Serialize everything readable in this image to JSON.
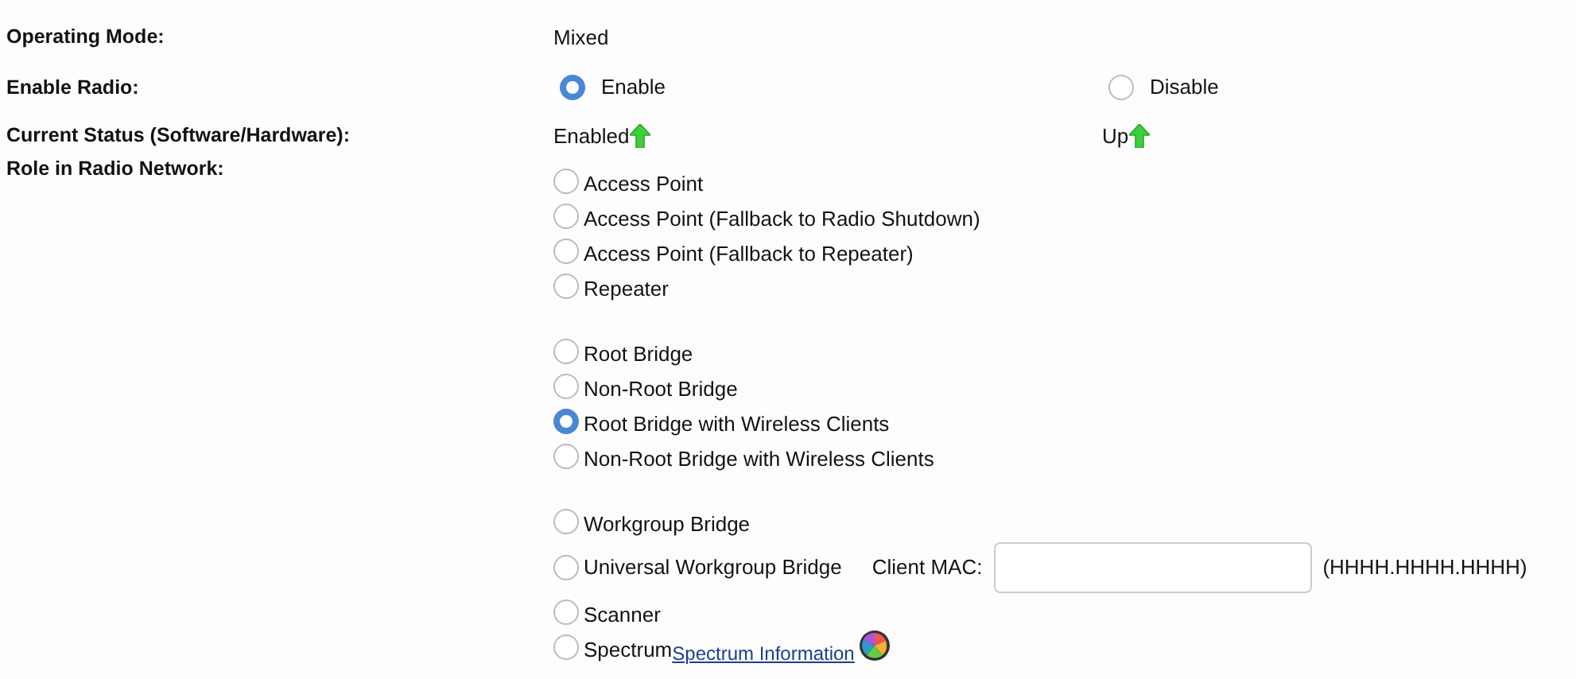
{
  "operating_mode": {
    "label": "Operating Mode:",
    "value": "Mixed"
  },
  "enable_radio": {
    "label": "Enable Radio:",
    "options": [
      {
        "label": "Enable",
        "selected": true
      },
      {
        "label": "Disable",
        "selected": false
      }
    ]
  },
  "current_status": {
    "label": "Current Status (Software/Hardware):",
    "values": [
      {
        "text": "Enabled",
        "up": true
      },
      {
        "text": "Up",
        "up": true
      }
    ]
  },
  "role": {
    "label": "Role in Radio Network:",
    "groups": [
      [
        {
          "kind": "plain",
          "label": "Access Point",
          "selected": false
        },
        {
          "kind": "plain",
          "label": "Access Point (Fallback to Radio Shutdown)",
          "selected": false
        },
        {
          "kind": "plain",
          "label": "Access Point (Fallback to Repeater)",
          "selected": false
        },
        {
          "kind": "plain",
          "label": "Repeater",
          "selected": false
        }
      ],
      [
        {
          "kind": "plain",
          "label": "Root Bridge",
          "selected": false
        },
        {
          "kind": "plain",
          "label": "Non-Root Bridge",
          "selected": false
        },
        {
          "kind": "plain",
          "label": "Root Bridge with Wireless Clients",
          "selected": true
        },
        {
          "kind": "plain",
          "label": "Non-Root Bridge with Wireless Clients",
          "selected": false
        }
      ],
      [
        {
          "kind": "plain",
          "label": "Workgroup Bridge",
          "selected": false
        },
        {
          "kind": "mac",
          "label": "Universal Workgroup Bridge",
          "selected": false,
          "field_label": "Client MAC:",
          "format_hint": "(HHHH.HHHH.HHHH)"
        },
        {
          "kind": "plain",
          "label": "Scanner",
          "selected": false
        },
        {
          "kind": "spectrum",
          "label": "Spectrum",
          "selected": false,
          "link": "Spectrum Information"
        }
      ]
    ]
  }
}
